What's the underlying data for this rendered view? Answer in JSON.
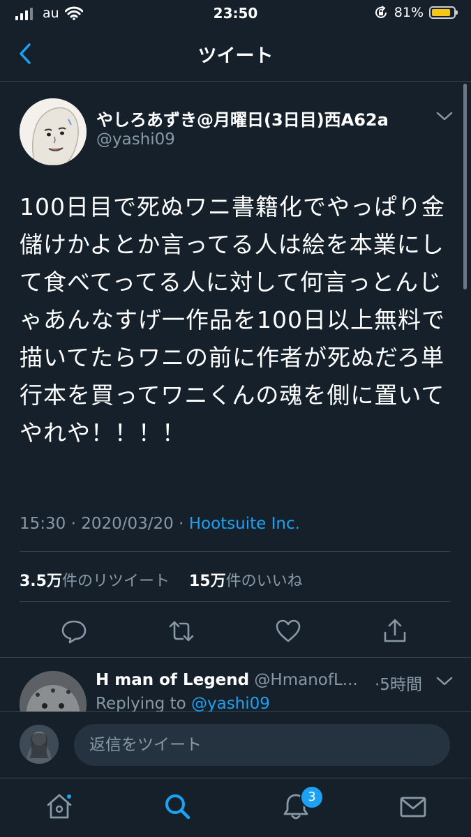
{
  "status_bar": {
    "carrier": "au",
    "time": "23:50",
    "battery": "81%",
    "battery_level": 0.81
  },
  "header": {
    "title": "ツイート"
  },
  "tweet": {
    "author_name": "やしろあずき@月曜日(3日目)西A62a",
    "author_handle": "@yashi09",
    "text": "100日目で死ぬワニ書籍化でやっぱり金儲けかよとか言ってる人は絵を本業にして食べてってる人に対して何言っとんじゃあんなすげ一作品を100日以上無料で描いてたらワニの前に作者が死ぬだろ単行本を買ってワニくんの魂を側に置いてやれや！！！！",
    "timestamp": "15:30 · 2020/03/20 · ",
    "source": "Hootsuite Inc.",
    "retweet_count": "3.5万",
    "retweet_label": "件のリツイート",
    "like_count": "15万",
    "like_label": "件のいいね"
  },
  "reply_preview": {
    "name": "H man of Legend",
    "handle": "@HmanofL...",
    "time": "·5時間",
    "replying_prefix": "Replying to ",
    "replying_to": "@yashi09"
  },
  "compose": {
    "placeholder": "返信をツイート"
  },
  "tabbar": {
    "notifications_badge": "3"
  },
  "colors": {
    "background": "#15202b",
    "accent": "#1da1f2",
    "secondary_text": "#8899a6",
    "divider": "#38444d"
  }
}
